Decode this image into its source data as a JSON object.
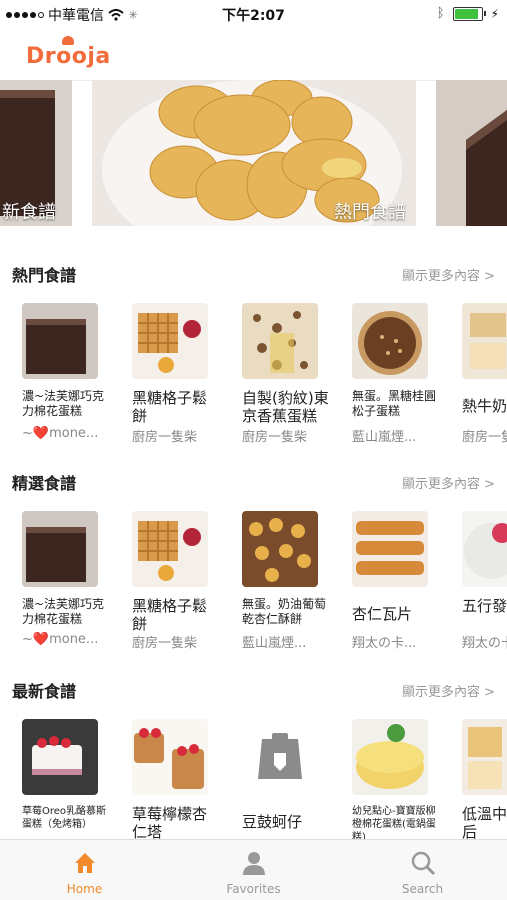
{
  "status": {
    "carrier": "中華電信",
    "time": "下午2:07",
    "battery_level": 0.9
  },
  "app": {
    "logo": "Drooja"
  },
  "carousel": {
    "left_label": "新食譜",
    "center_label": "熱門食譜"
  },
  "sections": [
    {
      "title": "熱門食譜",
      "more": "顯示更多內容 >",
      "cards": [
        {
          "title": "濃~法芙娜巧克力棉花蛋糕",
          "author": "~❤️mone..."
        },
        {
          "title": "黑糖格子鬆餅",
          "author": "廚房一隻柴"
        },
        {
          "title": "自製(豹紋)東京香蕉蛋糕",
          "author": "廚房一隻柴"
        },
        {
          "title": "無蛋。黑糖桂圓松子蛋糕",
          "author": "藍山嵐煙..."
        },
        {
          "title": "熱牛奶",
          "author": "廚房一隻"
        }
      ]
    },
    {
      "title": "精選食譜",
      "more": "顯示更多內容 >",
      "cards": [
        {
          "title": "濃~法芙娜巧克力棉花蛋糕",
          "author": "~❤️mone..."
        },
        {
          "title": "黑糖格子鬆餅",
          "author": "廚房一隻柴"
        },
        {
          "title": "無蛋。奶油葡萄乾杏仁酥餅",
          "author": "藍山嵐煙..."
        },
        {
          "title": "杏仁瓦片",
          "author": "翔太の卡..."
        },
        {
          "title": "五行發抹茶",
          "author": "翔太の卡"
        }
      ]
    },
    {
      "title": "最新食譜",
      "more": "顯示更多內容 >",
      "cards": [
        {
          "title": "草莓Oreo乳酪慕斯蛋糕（免烤箱）",
          "author": ""
        },
        {
          "title": "草莓檸檬杏仁塔",
          "author": ""
        },
        {
          "title": "豆鼓蚵仔",
          "author": ""
        },
        {
          "title": "幼兒點心-寶寶版柳橙棉花蛋糕(電鍋蛋糕)",
          "author": ""
        },
        {
          "title": "低溫中莉皇后",
          "author": ""
        }
      ]
    }
  ],
  "tabs": [
    {
      "label": "Home"
    },
    {
      "label": "Favorites"
    },
    {
      "label": "Search"
    }
  ]
}
